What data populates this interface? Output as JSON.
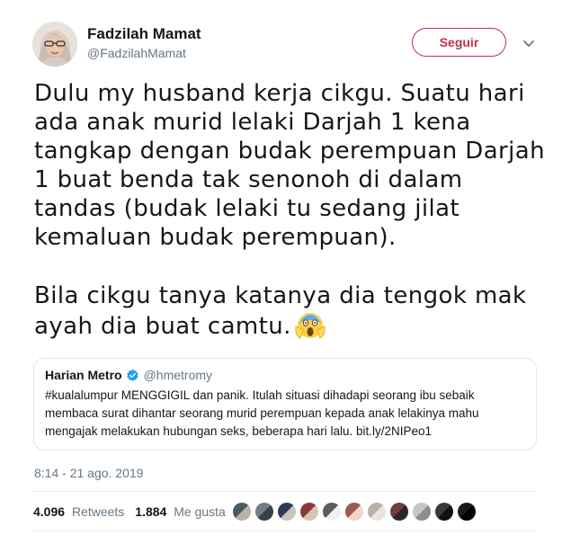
{
  "author": {
    "name": "Fadzilah Mamat",
    "handle": "@FadzilahMamat",
    "avatar_icon": "user-avatar-photo"
  },
  "follow_button": {
    "label": "Seguir",
    "color": "#c0304a"
  },
  "more_menu_icon": "chevron-down-icon",
  "tweet": {
    "paragraph1": "Dulu my husband kerja cikgu. Suatu hari ada anak murid lelaki Darjah 1 kena tangkap dengan budak perempuan Darjah 1 buat benda tak senonoh di dalam tandas (budak lelaki tu sedang jilat kemaluan budak perempuan).",
    "paragraph2": "Bila cikgu tanya katanya dia tengok mak ayah dia buat camtu.",
    "emoji": "screaming-face-emoji"
  },
  "quoted_tweet": {
    "name": "Harian Metro",
    "verified_icon": "verified-badge-icon",
    "handle": "@hmetromy",
    "text": "#kualalumpur MENGGIGIL dan panik. Itulah situasi dihadapi seorang ibu sebaik membaca surat dihantar seorang murid perempuan kepada anak lelakinya mahu mengajak melakukan hubungan seks, beberapa hari lalu. bit.ly/2NIPeo1"
  },
  "timestamp": "8:14 - 21 ago. 2019",
  "stats": {
    "retweets_count": "4.096",
    "retweets_label": "Retweets",
    "likes_count": "1.884",
    "likes_label": "Me gusta"
  },
  "likers": [
    {
      "colors": [
        "#4a5a64",
        "#b9b1a7"
      ]
    },
    {
      "colors": [
        "#6f7f88",
        "#3b3f46"
      ]
    },
    {
      "colors": [
        "#2c3a55",
        "#c9c3bc"
      ]
    },
    {
      "colors": [
        "#8b3a3a",
        "#d9c2b0"
      ]
    },
    {
      "colors": [
        "#5c5c5c",
        "#efefef"
      ]
    },
    {
      "colors": [
        "#9a5b4b",
        "#f0d5c8"
      ]
    },
    {
      "colors": [
        "#b6b1ab",
        "#e9e4df"
      ]
    },
    {
      "colors": [
        "#6e3d3d",
        "#2e2424"
      ]
    },
    {
      "colors": [
        "#c7c7c7",
        "#8d8d8d"
      ]
    },
    {
      "colors": [
        "#3a3a3a",
        "#101010"
      ]
    },
    {
      "colors": [
        "#1a1a1a",
        "#000000"
      ]
    }
  ]
}
